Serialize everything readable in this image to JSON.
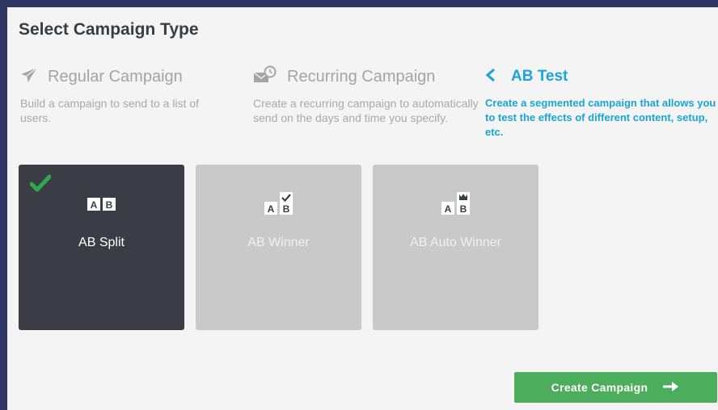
{
  "title": "Select Campaign Type",
  "campaign_types": [
    {
      "label": "Regular Campaign",
      "description": "Build a campaign to send to a list of users.",
      "icon": "paper-plane-icon"
    },
    {
      "label": "Recurring Campaign",
      "description": "Create a recurring campaign to automatically send on the days and time you specify.",
      "icon": "recurring-mail-icon"
    },
    {
      "label": "AB Test",
      "description": "Create a segmented campaign that allows you to test the effects of different content, setup, etc.",
      "icon": "back-chevron-icon"
    }
  ],
  "ab_options": [
    {
      "label": "AB Split",
      "selected": true,
      "icon": "ab-split-icon"
    },
    {
      "label": "AB Winner",
      "selected": false,
      "icon": "ab-winner-icon"
    },
    {
      "label": "AB Auto Winner",
      "selected": false,
      "icon": "ab-auto-winner-icon"
    }
  ],
  "create_button": {
    "label": "Create Campaign",
    "icon": "arrow-right-icon"
  },
  "colors": {
    "accent": "#19a5d7",
    "selected_tile": "#3a3d46",
    "tile": "#c9c9c9",
    "button": "#4cad5c",
    "check": "#2fa84f",
    "frame": "#2f3561"
  }
}
